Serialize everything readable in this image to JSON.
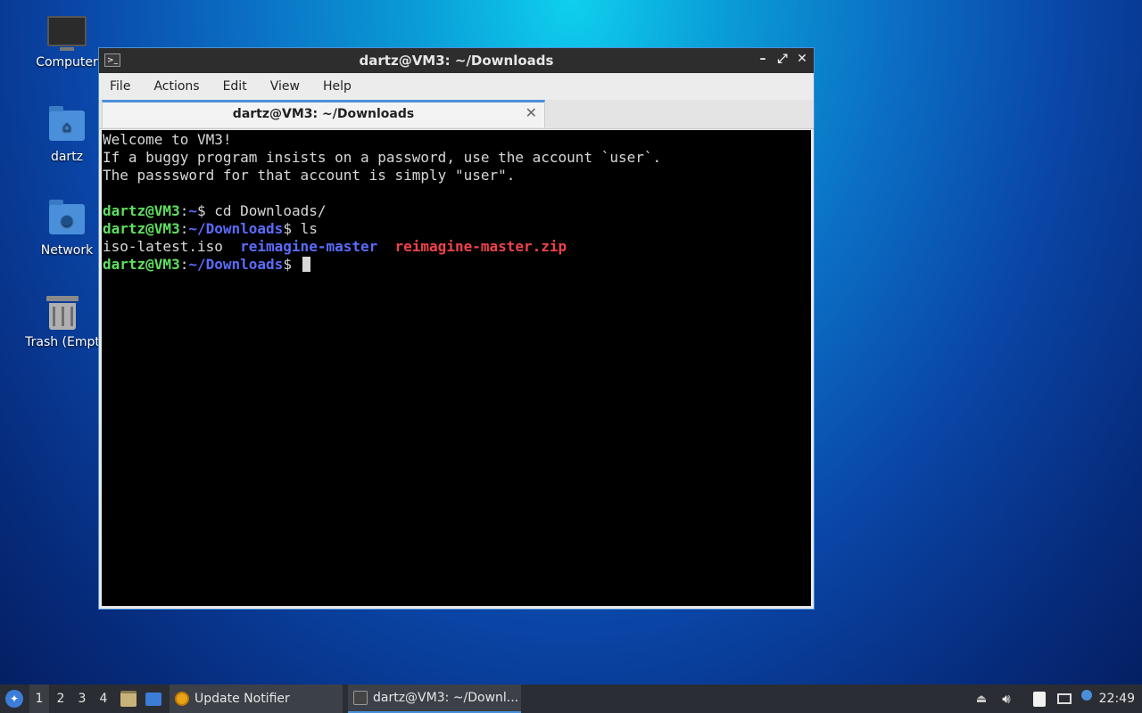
{
  "desktop": {
    "icons": [
      {
        "label": "Computer",
        "icon": "computer-icon"
      },
      {
        "label": "dartz",
        "icon": "home-folder-icon"
      },
      {
        "label": "Network",
        "icon": "network-folder-icon"
      },
      {
        "label": "Trash (Empt",
        "icon": "trash-icon"
      }
    ]
  },
  "window": {
    "title": "dartz@VM3: ~/Downloads",
    "controls": {
      "minimize": "–",
      "maximize": "⤢",
      "close": "✕"
    },
    "menu": [
      "File",
      "Actions",
      "Edit",
      "View",
      "Help"
    ],
    "tab": {
      "label": "dartz@VM3: ~/Downloads",
      "close": "✕"
    }
  },
  "terminal": {
    "welcome": [
      "Welcome to VM3!",
      "If a buggy program insists on a password, use the account `user`.",
      "The passsword for that account is simply \"user\"."
    ],
    "prompt_user": "dartz@VM3",
    "cmd1": {
      "cwd": "~",
      "suffix": "$ ",
      "command": "cd Downloads/"
    },
    "cmd2": {
      "cwd": "~/Downloads",
      "suffix": "$ ",
      "command": "ls"
    },
    "ls_output": [
      {
        "name": "iso-latest.iso",
        "kind": "file"
      },
      {
        "name": "reimagine-master",
        "kind": "directory"
      },
      {
        "name": "reimagine-master.zip",
        "kind": "archive"
      }
    ],
    "cmd3": {
      "cwd": "~/Downloads",
      "suffix": "$ "
    }
  },
  "taskbar": {
    "workspaces": [
      "1",
      "2",
      "3",
      "4"
    ],
    "tasks": [
      {
        "label": "Update Notifier"
      },
      {
        "label": "dartz@VM3: ~/Downl..."
      }
    ],
    "clock": "22:49"
  },
  "colors": {
    "prompt_green": "#5fe05f",
    "dir_blue": "#5a6cff",
    "archive_red": "#f0424a",
    "accent": "#4a90d9"
  }
}
